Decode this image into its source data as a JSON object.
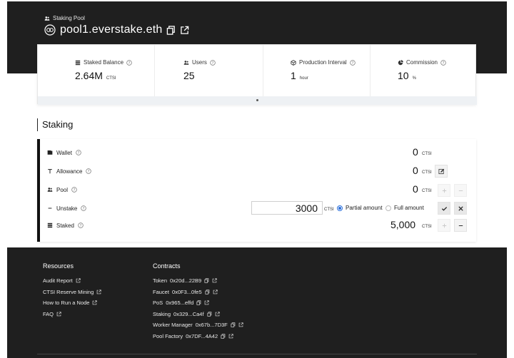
{
  "header": {
    "breadcrumb": "Staking Pool",
    "title": "pool1.everstake.eth"
  },
  "stats": [
    {
      "label": "Staked Balance",
      "value": "2.64M",
      "unit": "CTSI",
      "icon": "coins-icon"
    },
    {
      "label": "Users",
      "value": "25",
      "unit": "",
      "icon": "users-icon"
    },
    {
      "label": "Production Interval",
      "value": "1",
      "unit": "hour",
      "icon": "cube-icon"
    },
    {
      "label": "Commission",
      "value": "10",
      "unit": "%",
      "icon": "pie-chart-icon"
    }
  ],
  "staking": {
    "title": "Staking",
    "rows": {
      "wallet": {
        "label": "Wallet",
        "value": "0",
        "unit": "CTSI"
      },
      "allowance": {
        "label": "Allowance",
        "value": "0",
        "unit": "CTSI"
      },
      "pool": {
        "label": "Pool",
        "value": "0",
        "unit": "CTSI"
      },
      "unstake": {
        "label": "Unstake",
        "value": "3000",
        "unit": "CTSI",
        "partial_label": "Partial amount",
        "full_label": "Full amount",
        "selected": "partial"
      },
      "staked": {
        "label": "Staked",
        "value": "5,000",
        "unit": "CTSI"
      }
    }
  },
  "footer": {
    "resources_title": "Resources",
    "resources": [
      "Audit Report",
      "CTSI Reserve Mining",
      "How to Run a Node",
      "FAQ"
    ],
    "contracts_title": "Contracts",
    "contracts": [
      {
        "name": "Token",
        "address": "0x20d...22B9"
      },
      {
        "name": "Faucet",
        "address": "0x0F3...0fe5"
      },
      {
        "name": "PoS",
        "address": "0x965...effd"
      },
      {
        "name": "Staking",
        "address": "0x329...Ca4f"
      },
      {
        "name": "Worker Manager",
        "address": "0x67b...7D3F"
      },
      {
        "name": "Pool Factory",
        "address": "0x7DF...4A42"
      }
    ]
  },
  "colors": {
    "background_dark": "#1f1f1f",
    "accent": "#2a6fdb"
  }
}
